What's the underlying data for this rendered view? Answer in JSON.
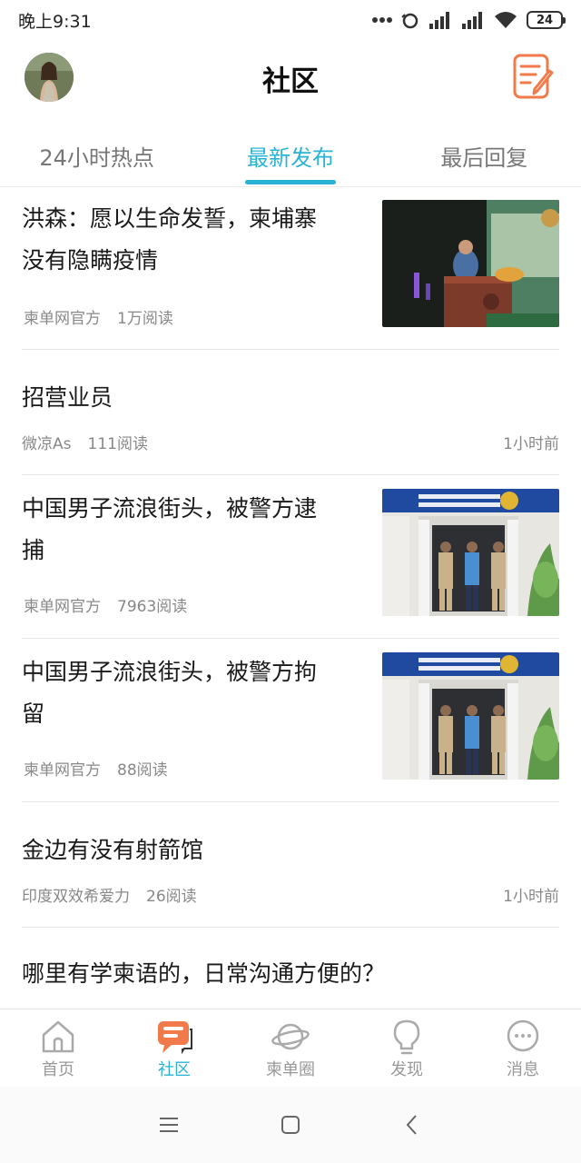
{
  "status": {
    "time": "晚上9:31",
    "battery": "24",
    "icons": [
      "more-dots-icon",
      "alarm-icon",
      "signal-icon",
      "signal-icon",
      "wifi-icon",
      "battery-icon"
    ]
  },
  "header": {
    "title": "社区",
    "avatar_icon": "user-avatar",
    "compose_icon": "compose-icon",
    "accent": "#f07a4a"
  },
  "tabs": [
    {
      "label": "24小时热点",
      "active": false
    },
    {
      "label": "最新发布",
      "active": true
    },
    {
      "label": "最后回复",
      "active": false
    }
  ],
  "accent_color": "#2bb3d4",
  "posts": [
    {
      "title_line1": "洪森：愿以生命发誓，柬埔寨",
      "title_line2": "没有隐瞒疫情",
      "author": "柬单网官方",
      "reads": "1万阅读",
      "time": "",
      "has_image": true,
      "image": "speaker-at-podium"
    },
    {
      "title_line1": "招营业员",
      "title_line2": "",
      "author": "微凉As",
      "reads": "111阅读",
      "time": "1小时前",
      "has_image": false
    },
    {
      "title_line1": "中国男子流浪街头，被警方逮",
      "title_line2": "捕",
      "author": "柬单网官方",
      "reads": "7963阅读",
      "time": "",
      "has_image": true,
      "image": "police-station-photo"
    },
    {
      "title_line1": "中国男子流浪街头，被警方拘",
      "title_line2": "留",
      "author": "柬单网官方",
      "reads": "88阅读",
      "time": "",
      "has_image": true,
      "image": "police-station-photo"
    },
    {
      "title_line1": "金边有没有射箭馆",
      "title_line2": "",
      "author": "印度双效希爱力",
      "reads": "26阅读",
      "time": "1小时前",
      "has_image": false
    },
    {
      "title_line1": "哪里有学柬语的，日常沟通方便的？",
      "title_line2": "",
      "author": "",
      "reads": "",
      "time": "",
      "has_image": false
    }
  ],
  "bottom_nav": [
    {
      "label": "首页",
      "icon": "home-icon",
      "active": false
    },
    {
      "label": "社区",
      "icon": "community-chat-icon",
      "active": true
    },
    {
      "label": "柬单圈",
      "icon": "planet-icon",
      "active": false
    },
    {
      "label": "发现",
      "icon": "lightbulb-icon",
      "active": false
    },
    {
      "label": "消息",
      "icon": "message-bubble-icon",
      "active": false
    }
  ],
  "system_nav": [
    "menu-icon",
    "home-square-icon",
    "back-icon"
  ]
}
